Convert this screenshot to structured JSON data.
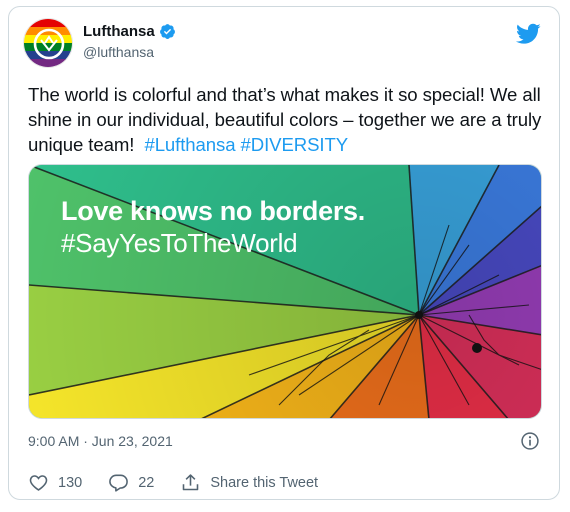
{
  "account": {
    "display_name": "Lufthansa",
    "handle": "@lufthansa",
    "verified": true
  },
  "tweet": {
    "text": "The world is colorful and that’s what makes it so special! We all shine in our individual, beautiful colors – together we are a truly unique team!",
    "hashtags": [
      "#Lufthansa",
      "#DIVERSITY"
    ],
    "media": {
      "line1": "Love knows no borders.",
      "line2": "#SayYesToTheWorld"
    },
    "timestamp": "9:00 AM · Jun 23, 2021"
  },
  "actions": {
    "like_count": "130",
    "reply_count": "22",
    "share_label": "Share this Tweet"
  },
  "colors": {
    "accent": "#1d9bf0",
    "secondary_text": "#536471",
    "border": "#cfd9de"
  },
  "icons": [
    "twitter-bird-icon",
    "verified-badge-icon",
    "info-icon",
    "heart-icon",
    "reply-icon",
    "share-icon"
  ]
}
